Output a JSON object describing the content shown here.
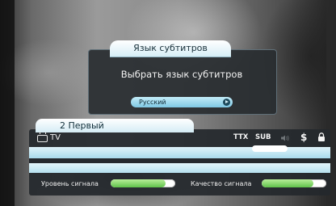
{
  "dialog": {
    "title": "Язык субтитров",
    "prompt": "Выбрать язык субтитров",
    "selected_language": "Русский"
  },
  "channel": {
    "name": "2 Первый",
    "type_label": "TV",
    "icons": [
      "ttx-indicator",
      "sub-indicator",
      "speaker-icon",
      "dollar-icon",
      "lock-icon"
    ],
    "ttx_label": "TTX",
    "sub_label": "SUB",
    "dollar_label": "$"
  },
  "signal": {
    "level_label": "Уровень сигнала",
    "quality_label": "Качество сигнала",
    "level_fraction": 0.85,
    "quality_fraction": 0.8,
    "fill_color": "#5fc24a"
  }
}
